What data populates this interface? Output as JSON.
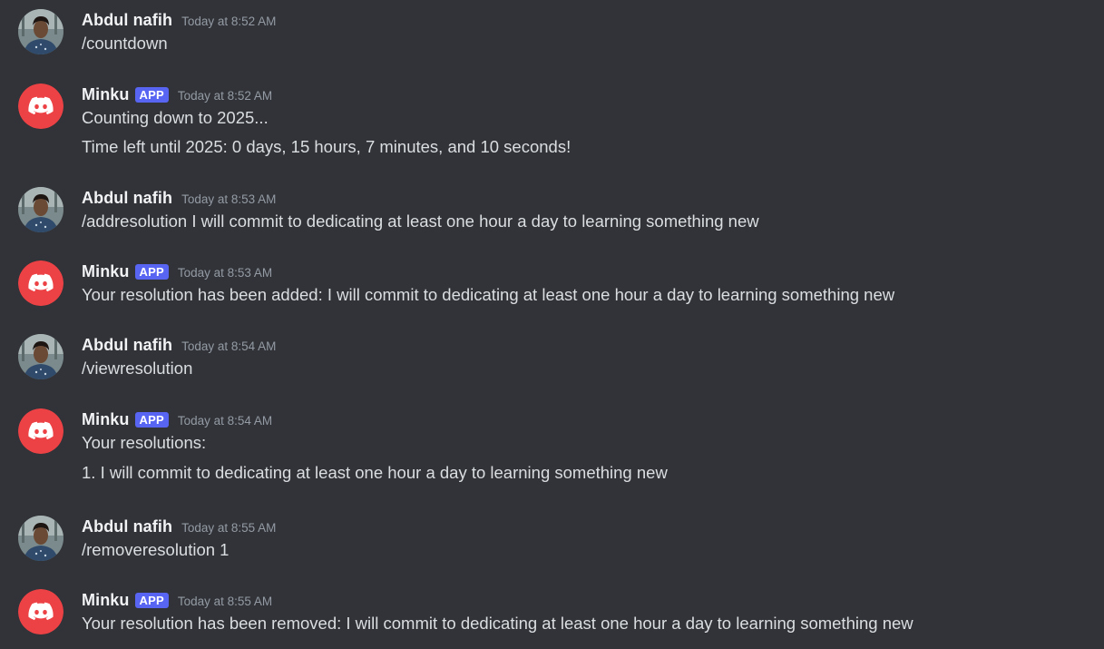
{
  "messages": [
    {
      "author": "Abdul nafih",
      "is_app": false,
      "timestamp": "Today at 8:52 AM",
      "lines": [
        "/countdown"
      ]
    },
    {
      "author": "Minku",
      "is_app": true,
      "badge": "APP",
      "timestamp": "Today at 8:52 AM",
      "lines": [
        "Counting down to 2025...",
        "Time left until 2025: 0 days, 15 hours, 7 minutes, and 10 seconds!"
      ]
    },
    {
      "author": "Abdul nafih",
      "is_app": false,
      "timestamp": "Today at 8:53 AM",
      "lines": [
        "/addresolution I will commit to dedicating at least one hour a day to learning something new"
      ]
    },
    {
      "author": "Minku",
      "is_app": true,
      "badge": "APP",
      "timestamp": "Today at 8:53 AM",
      "lines": [
        "Your resolution has been added: I will commit to dedicating at least one hour a day to learning something new"
      ]
    },
    {
      "author": "Abdul nafih",
      "is_app": false,
      "timestamp": "Today at 8:54 AM",
      "lines": [
        "/viewresolution"
      ]
    },
    {
      "author": "Minku",
      "is_app": true,
      "badge": "APP",
      "timestamp": "Today at 8:54 AM",
      "lines": [
        "Your resolutions:",
        "1. I will commit to dedicating at least one hour a day to learning something new"
      ]
    },
    {
      "author": "Abdul nafih",
      "is_app": false,
      "timestamp": "Today at 8:55 AM",
      "lines": [
        "/removeresolution 1"
      ]
    },
    {
      "author": "Minku",
      "is_app": true,
      "badge": "APP",
      "timestamp": "Today at 8:55 AM",
      "lines": [
        "Your resolution has been removed: I will commit to dedicating at least one hour a day to learning something new"
      ]
    }
  ],
  "colors": {
    "background": "#313338",
    "bot_avatar": "#ed4245",
    "app_badge": "#5865f2",
    "username": "#f2f3f5",
    "timestamp": "#949ba4",
    "text": "#dbdee1"
  },
  "icons": {
    "user_avatar": "user-photo-avatar",
    "bot_avatar": "discord-logo-icon"
  }
}
